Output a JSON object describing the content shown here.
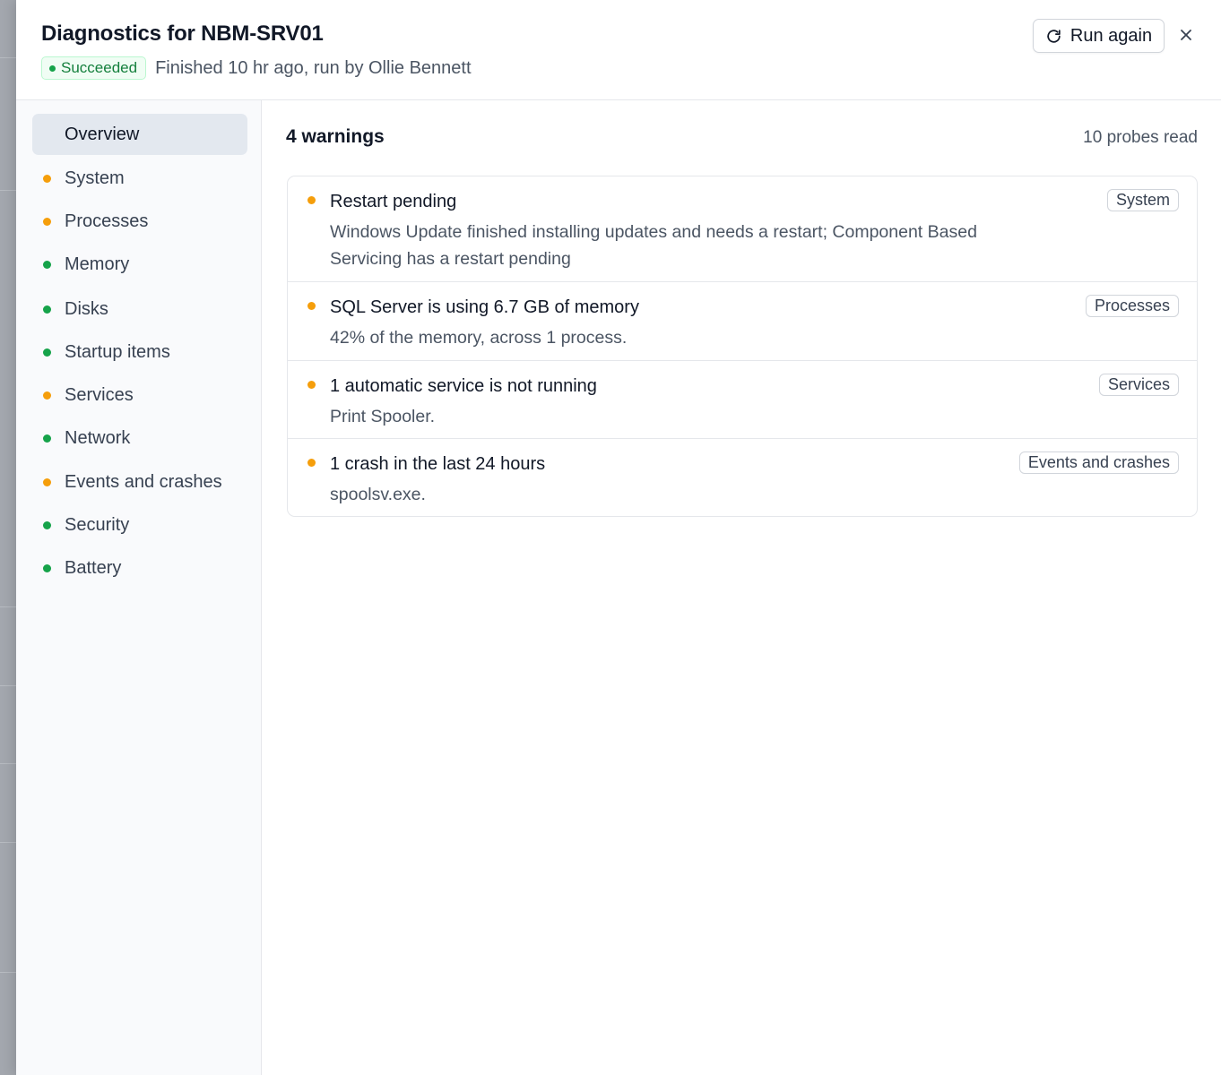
{
  "colors": {
    "warning": "#f59e0b",
    "ok": "#16a34a",
    "success_text": "#15803d"
  },
  "header": {
    "title": "Diagnostics for NBM-SRV01",
    "status_badge": "Succeeded",
    "meta": "Finished 10 hr ago, run by Ollie Bennett",
    "run_again_label": "Run again",
    "run_again_icon": "refresh-icon",
    "close_icon": "close-icon"
  },
  "sidebar": {
    "items": [
      {
        "label": "Overview",
        "status": "none",
        "active": true
      },
      {
        "label": "System",
        "status": "warning"
      },
      {
        "label": "Processes",
        "status": "warning"
      },
      {
        "label": "Memory",
        "status": "ok"
      },
      {
        "label": "Disks",
        "status": "ok"
      },
      {
        "label": "Startup items",
        "status": "ok"
      },
      {
        "label": "Services",
        "status": "warning"
      },
      {
        "label": "Network",
        "status": "ok"
      },
      {
        "label": "Events and crashes",
        "status": "warning"
      },
      {
        "label": "Security",
        "status": "ok"
      },
      {
        "label": "Battery",
        "status": "ok"
      }
    ]
  },
  "main": {
    "warnings_title": "4 warnings",
    "probes_read": "10 probes read",
    "warnings": [
      {
        "title": "Restart pending",
        "description": "Windows Update finished installing updates and needs a restart; Component Based Servicing has a restart pending",
        "tag": "System"
      },
      {
        "title": "SQL Server is using 6.7 GB of memory",
        "description": "42% of the memory, across 1 process.",
        "tag": "Processes"
      },
      {
        "title": "1 automatic service is not running",
        "description": "Print Spooler.",
        "tag": "Services"
      },
      {
        "title": "1 crash in the last 24 hours",
        "description": "spoolsv.exe.",
        "tag": "Events and crashes"
      }
    ]
  }
}
